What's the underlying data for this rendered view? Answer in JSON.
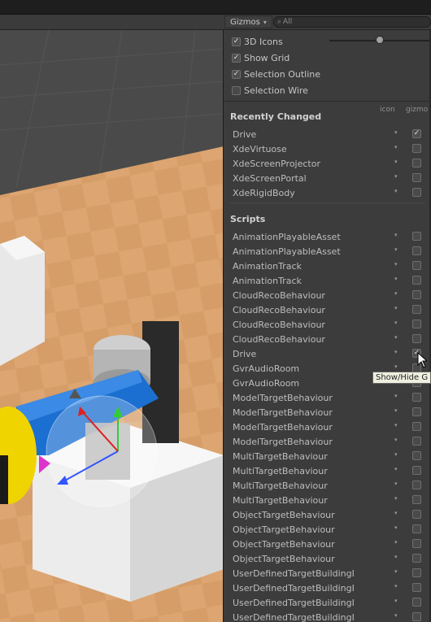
{
  "toolbar": {
    "gizmos_label": "Gizmos",
    "search_placeholder": "All",
    "search_icon": "search-icon"
  },
  "options": [
    {
      "label": "3D Icons",
      "checked": true
    },
    {
      "label": "Show Grid",
      "checked": true
    },
    {
      "label": "Selection Outline",
      "checked": true
    },
    {
      "label": "Selection Wire",
      "checked": false
    }
  ],
  "columns": {
    "icon": "icon",
    "gizmo": "gizmo"
  },
  "recently_changed": {
    "title": "Recently Changed",
    "items": [
      {
        "name": "Drive",
        "gizmo": true
      },
      {
        "name": "XdeVirtuose",
        "gizmo": false
      },
      {
        "name": "XdeScreenProjector",
        "gizmo": false
      },
      {
        "name": "XdeScreenPortal",
        "gizmo": false
      },
      {
        "name": "XdeRigidBody",
        "gizmo": false
      }
    ]
  },
  "scripts": {
    "title": "Scripts",
    "items": [
      {
        "name": "AnimationPlayableAsset",
        "gizmo": false
      },
      {
        "name": "AnimationPlayableAsset",
        "gizmo": false
      },
      {
        "name": "AnimationTrack",
        "gizmo": false
      },
      {
        "name": "AnimationTrack",
        "gizmo": false
      },
      {
        "name": "CloudRecoBehaviour",
        "gizmo": false
      },
      {
        "name": "CloudRecoBehaviour",
        "gizmo": false
      },
      {
        "name": "CloudRecoBehaviour",
        "gizmo": false
      },
      {
        "name": "CloudRecoBehaviour",
        "gizmo": false
      },
      {
        "name": "Drive",
        "gizmo": true
      },
      {
        "name": "GvrAudioRoom",
        "gizmo": false
      },
      {
        "name": "GvrAudioRoom",
        "gizmo": false
      },
      {
        "name": "ModelTargetBehaviour",
        "gizmo": false
      },
      {
        "name": "ModelTargetBehaviour",
        "gizmo": false
      },
      {
        "name": "ModelTargetBehaviour",
        "gizmo": false
      },
      {
        "name": "ModelTargetBehaviour",
        "gizmo": false
      },
      {
        "name": "MultiTargetBehaviour",
        "gizmo": false
      },
      {
        "name": "MultiTargetBehaviour",
        "gizmo": false
      },
      {
        "name": "MultiTargetBehaviour",
        "gizmo": false
      },
      {
        "name": "MultiTargetBehaviour",
        "gizmo": false
      },
      {
        "name": "ObjectTargetBehaviour",
        "gizmo": false
      },
      {
        "name": "ObjectTargetBehaviour",
        "gizmo": false
      },
      {
        "name": "ObjectTargetBehaviour",
        "gizmo": false
      },
      {
        "name": "ObjectTargetBehaviour",
        "gizmo": false
      },
      {
        "name": "UserDefinedTargetBuildingI",
        "gizmo": false
      },
      {
        "name": "UserDefinedTargetBuildingI",
        "gizmo": false
      },
      {
        "name": "UserDefinedTargetBuildingI",
        "gizmo": false
      },
      {
        "name": "UserDefinedTargetBuildingI",
        "gizmo": false
      }
    ]
  },
  "tooltip": "Show/Hide G",
  "colors": {
    "panel_bg": "#3c3c3c",
    "floor": "#d9a06a",
    "robot_blue": "#1b6fd1",
    "robot_yellow": "#f0d400"
  }
}
